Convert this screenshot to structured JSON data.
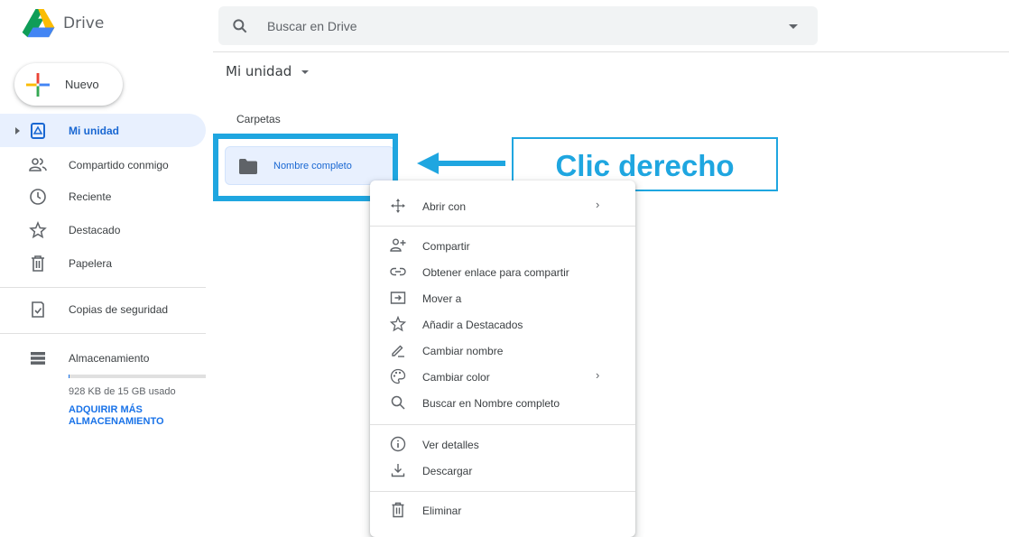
{
  "app": {
    "name": "Drive"
  },
  "search": {
    "placeholder": "Buscar en Drive"
  },
  "sidebar": {
    "new_label": "Nuevo",
    "items": [
      {
        "label": "Mi unidad",
        "icon": "drive-icon",
        "active": true
      },
      {
        "label": "Compartido conmigo",
        "icon": "shared-people-icon"
      },
      {
        "label": "Reciente",
        "icon": "clock-icon"
      },
      {
        "label": "Destacado",
        "icon": "star-icon"
      },
      {
        "label": "Papelera",
        "icon": "trash-icon"
      }
    ],
    "backups_label": "Copias de seguridad",
    "storage": {
      "label": "Almacenamiento",
      "usage_text": "928 KB de 15 GB usado",
      "buy_label": "ADQUIRIR MÁS ALMACENAMIENTO",
      "used_fraction": 0.0001
    }
  },
  "main": {
    "breadcrumb": "Mi unidad",
    "section_title": "Carpetas",
    "folder_name": "Nombre completo"
  },
  "annotation": {
    "callout_text": "Clic derecho",
    "color": "#1fa6e0"
  },
  "context_menu": {
    "items": [
      {
        "label": "Abrir con",
        "icon": "open-with-icon",
        "submenu": "›"
      },
      {
        "label": "Compartir",
        "icon": "share-person-icon"
      },
      {
        "label": "Obtener enlace para compartir",
        "icon": "link-icon"
      },
      {
        "label": "Mover a",
        "icon": "move-to-icon"
      },
      {
        "label": "Añadir a Destacados",
        "icon": "star-outline-icon"
      },
      {
        "label": "Cambiar nombre",
        "icon": "pencil-icon"
      },
      {
        "label": "Cambiar color",
        "icon": "palette-icon",
        "submenu": "›"
      },
      {
        "label": "Buscar en Nombre completo",
        "icon": "search-icon"
      },
      {
        "label": "Ver detalles",
        "icon": "info-icon"
      },
      {
        "label": "Descargar",
        "icon": "download-icon"
      },
      {
        "label": "Eliminar",
        "icon": "trash-icon"
      }
    ]
  },
  "colors": {
    "accent": "#1a73e8",
    "active_bg": "#e8f0fe",
    "annotation": "#1fa6e0"
  }
}
